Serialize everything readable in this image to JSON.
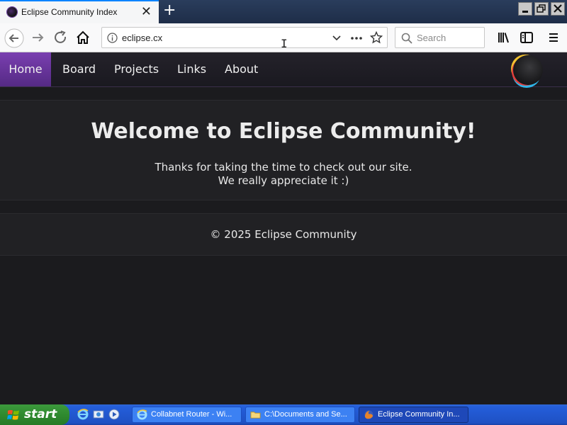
{
  "browser": {
    "tab_title": "Eclipse Community Index",
    "url": "eclipse.cx",
    "search_placeholder": "Search"
  },
  "site": {
    "nav": [
      "Home",
      "Board",
      "Projects",
      "Links",
      "About"
    ],
    "active_nav": "Home",
    "welcome_title": "Welcome to Eclipse Community!",
    "welcome_line1": "Thanks for taking the time to check out our site.",
    "welcome_line2": "We really appreciate it :)",
    "footer": "© 2025 Eclipse Community"
  },
  "taskbar": {
    "start_label": "start",
    "tasks": [
      {
        "label": "Collabnet Router - Wi...",
        "icon": "ie-icon"
      },
      {
        "label": "C:\\Documents and Se...",
        "icon": "folder-icon"
      },
      {
        "label": "Eclipse Community In...",
        "icon": "firefox-icon",
        "active": true
      }
    ]
  },
  "colors": {
    "accent_purple": "#7a3fb0",
    "page_bg": "#1b1b1e",
    "xp_blue": "#245edb",
    "start_green": "#2f8a2f"
  }
}
